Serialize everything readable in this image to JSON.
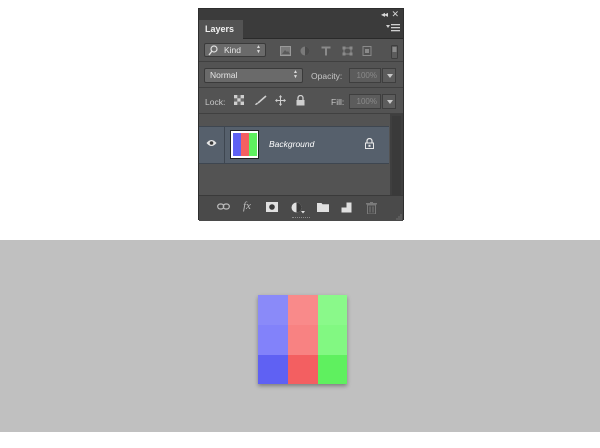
{
  "panel": {
    "collapse_glyph": "◂◂",
    "close_glyph": "✕",
    "tab_label": "Layers",
    "filter": {
      "kind_label": "Kind",
      "filter_icons": [
        "image-filter-icon",
        "adjustment-filter-icon",
        "type-filter-icon",
        "shape-filter-icon",
        "smart-object-filter-icon"
      ]
    },
    "blend_mode": "Normal",
    "opacity_label": "Opacity:",
    "opacity_value": "100%",
    "lock_label": "Lock:",
    "fill_label": "Fill:",
    "fill_value": "100%",
    "layers": [
      {
        "name": "Background",
        "visible": true,
        "locked": true,
        "thumb_colors": [
          "#5f61f3",
          "#f35f61",
          "#5ff05f"
        ]
      }
    ],
    "bottom_icons": [
      "link-layers-icon",
      "fx-icon",
      "add-mask-icon",
      "adjustment-layer-icon",
      "new-group-icon",
      "new-layer-icon",
      "delete-layer-icon"
    ],
    "fx_text": "fx"
  },
  "canvas": {
    "background": "#c0c0c0",
    "grid_colors": [
      [
        "#8a8af9",
        "#f98a8a",
        "#8af98a"
      ],
      [
        "#8282fa",
        "#f88282",
        "#82f882"
      ],
      [
        "#5f61f3",
        "#f35f61",
        "#5ff05f"
      ]
    ]
  }
}
